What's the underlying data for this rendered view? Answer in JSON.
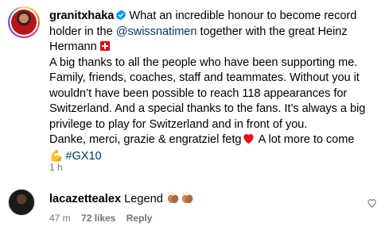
{
  "post": {
    "username": "granitxhaka",
    "caption_lines": [
      "What an incredible honour to become record",
      "holder in the ",
      "@swissnatimen",
      " together with the great Heinz",
      "Hermann",
      "A big thanks to all the people who have been supporting me.",
      "Family, friends, coaches, staff and teammates. Without you it",
      "wouldn’t have been possible to reach 118 appearances for",
      "Switzerland. And a special thanks to the fans. It’s always a big",
      "privilege to play for Switzerland and in front of you.",
      "Danke, merci, grazie & engratziel fetg",
      " A lot more to come",
      "#GX10"
    ],
    "muscle_emoji": "💪",
    "timestamp": "1 h"
  },
  "reply": {
    "username": "lacazettealex",
    "text": "Legend",
    "time": "47 m",
    "likes": "72 likes",
    "reply_label": "Reply"
  },
  "colors": {
    "link": "#00376b",
    "meta": "#737373",
    "verified": "#0095f6",
    "heart": "#ff3040"
  },
  "icons": [
    "verified-badge-icon",
    "swiss-flag-icon",
    "red-heart-icon",
    "muscle-icon",
    "clapping-hands-icon",
    "like-heart-icon"
  ]
}
